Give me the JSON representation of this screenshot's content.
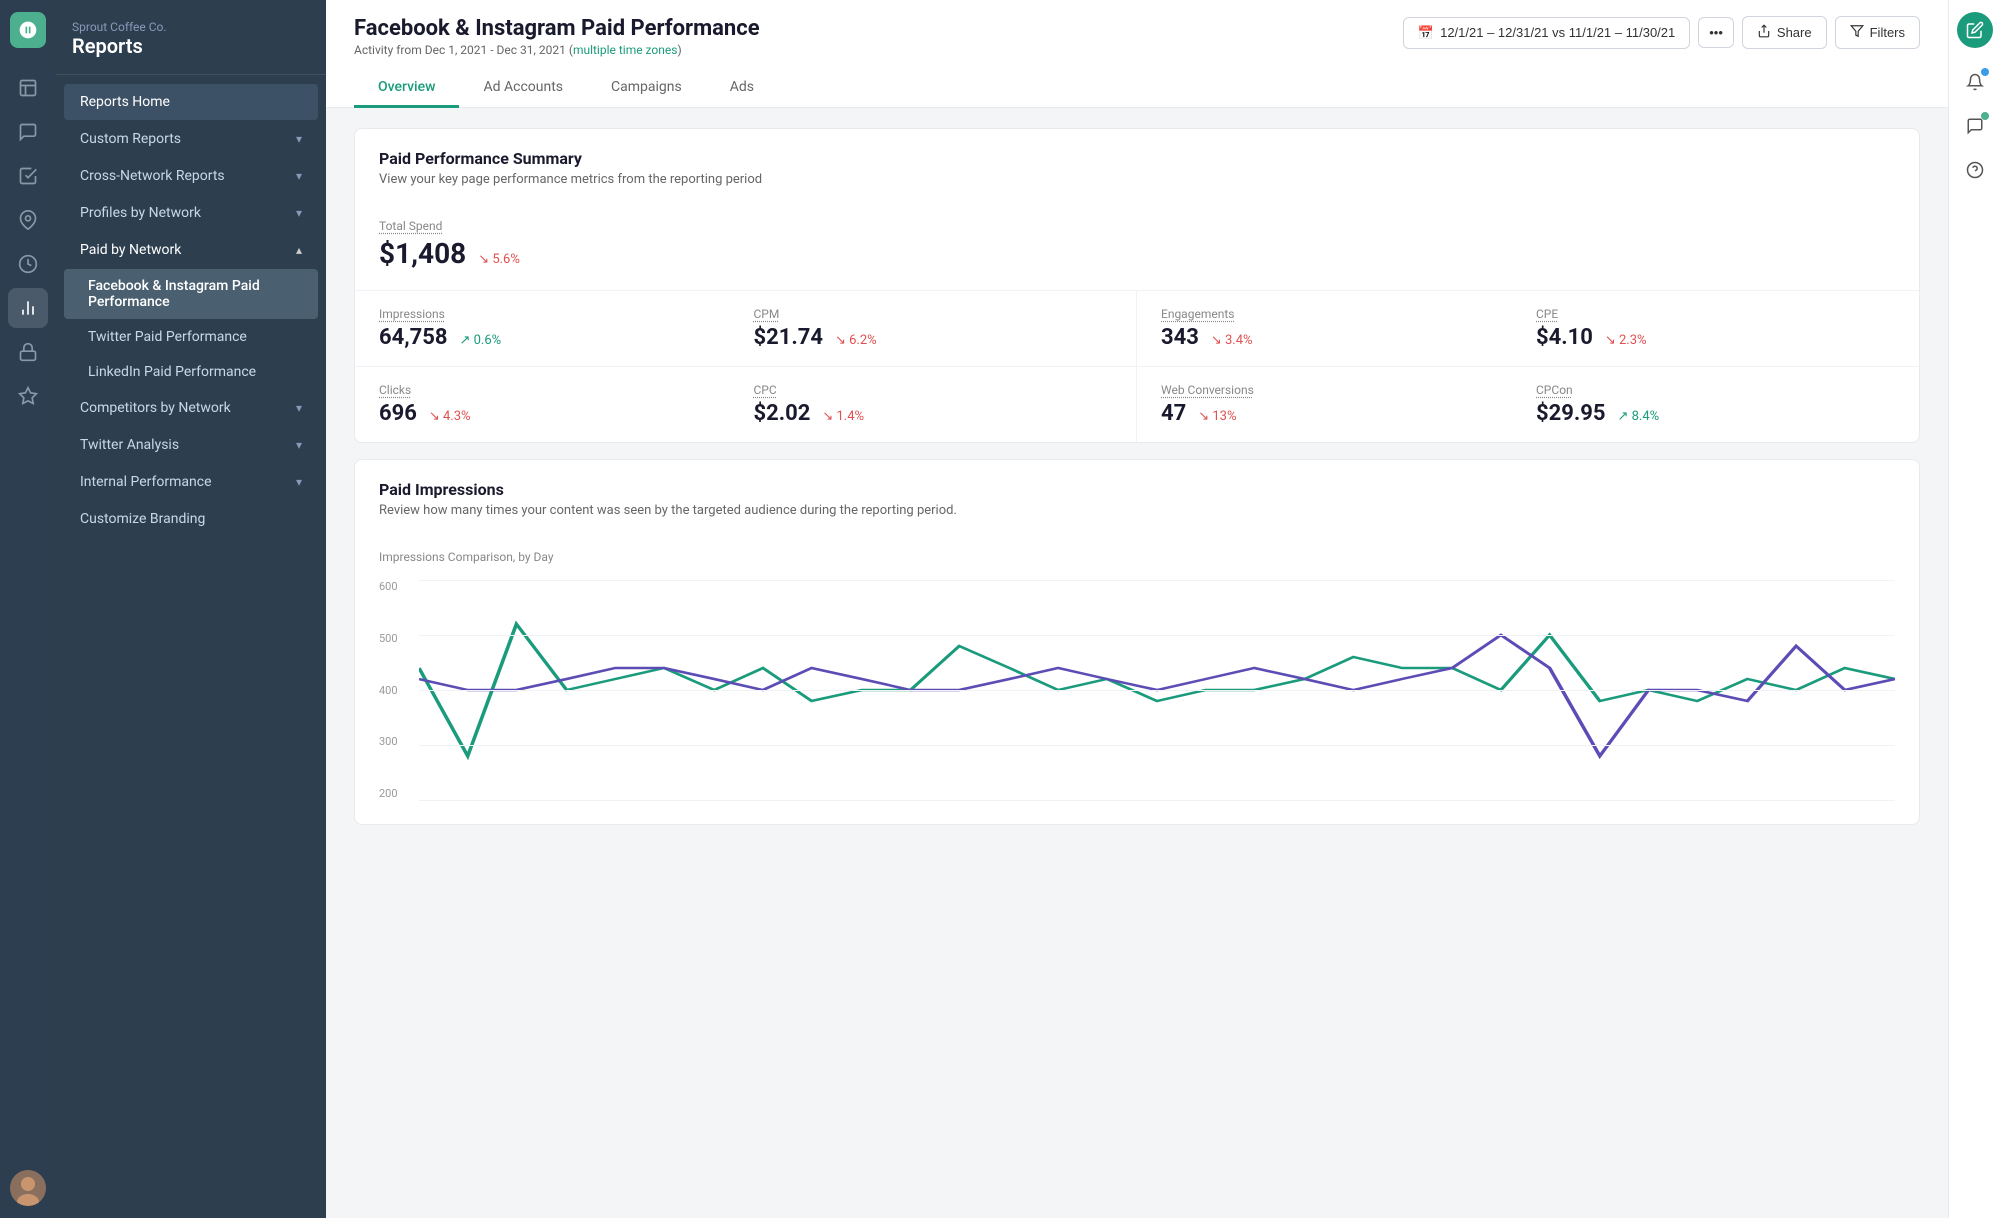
{
  "company": "Sprout Coffee Co.",
  "app_title": "Reports",
  "page_title": "Facebook & Instagram Paid Performance",
  "page_subtitle": "Activity from Dec 1, 2021 - Dec 31, 2021",
  "page_timezone": "multiple time zones",
  "date_range": "12/1/21 – 12/31/21 vs 11/1/21 – 11/30/21",
  "buttons": {
    "share": "Share",
    "filters": "Filters"
  },
  "tabs": [
    {
      "id": "overview",
      "label": "Overview",
      "active": true
    },
    {
      "id": "ad-accounts",
      "label": "Ad Accounts",
      "active": false
    },
    {
      "id": "campaigns",
      "label": "Campaigns",
      "active": false
    },
    {
      "id": "ads",
      "label": "Ads",
      "active": false
    }
  ],
  "sidebar": {
    "items": [
      {
        "id": "reports-home",
        "label": "Reports Home",
        "level": 0,
        "active": false,
        "has_chevron": false
      },
      {
        "id": "custom-reports",
        "label": "Custom Reports",
        "level": 0,
        "active": false,
        "has_chevron": true
      },
      {
        "id": "cross-network-reports",
        "label": "Cross-Network Reports",
        "level": 0,
        "active": false,
        "has_chevron": true
      },
      {
        "id": "profiles-by-network",
        "label": "Profiles by Network",
        "level": 0,
        "active": false,
        "has_chevron": true
      },
      {
        "id": "paid-by-network",
        "label": "Paid by Network",
        "level": 0,
        "active": true,
        "has_chevron": true
      },
      {
        "id": "fb-ig-paid",
        "label": "Facebook & Instagram Paid Performance",
        "level": 1,
        "active": true,
        "has_chevron": false
      },
      {
        "id": "twitter-paid",
        "label": "Twitter Paid Performance",
        "level": 1,
        "active": false,
        "has_chevron": false
      },
      {
        "id": "linkedin-paid",
        "label": "LinkedIn Paid Performance",
        "level": 1,
        "active": false,
        "has_chevron": false
      },
      {
        "id": "competitors-by-network",
        "label": "Competitors by Network",
        "level": 0,
        "active": false,
        "has_chevron": true
      },
      {
        "id": "twitter-analysis",
        "label": "Twitter Analysis",
        "level": 0,
        "active": false,
        "has_chevron": true
      },
      {
        "id": "internal-performance",
        "label": "Internal Performance",
        "level": 0,
        "active": false,
        "has_chevron": true
      },
      {
        "id": "customize-branding",
        "label": "Customize Branding",
        "level": 0,
        "active": false,
        "has_chevron": false
      }
    ]
  },
  "summary_card": {
    "title": "Paid Performance Summary",
    "subtitle": "View your key page performance metrics from the reporting period",
    "total_spend": {
      "label": "Total Spend",
      "value": "$1,408",
      "change": "5.6%",
      "direction": "down"
    },
    "metrics": [
      {
        "col": 0,
        "rows": [
          [
            {
              "label": "Impressions",
              "value": "64,758",
              "change": "0.6%",
              "direction": "up"
            },
            {
              "label": "CPM",
              "value": "$21.74",
              "change": "6.2%",
              "direction": "down"
            }
          ],
          [
            {
              "label": "Clicks",
              "value": "696",
              "change": "4.3%",
              "direction": "down"
            },
            {
              "label": "CPC",
              "value": "$2.02",
              "change": "1.4%",
              "direction": "down"
            }
          ]
        ]
      },
      {
        "col": 1,
        "rows": [
          [
            {
              "label": "Engagements",
              "value": "343",
              "change": "3.4%",
              "direction": "down"
            },
            {
              "label": "CPE",
              "value": "$4.10",
              "change": "2.3%",
              "direction": "down"
            }
          ],
          [
            {
              "label": "Web Conversions",
              "value": "47",
              "change": "13%",
              "direction": "down"
            },
            {
              "label": "CPCon",
              "value": "$29.95",
              "change": "8.4%",
              "direction": "up"
            }
          ]
        ]
      }
    ]
  },
  "impressions_card": {
    "title": "Paid Impressions",
    "subtitle": "Review how many times your content was seen by the targeted audience during the reporting period.",
    "chart_label": "Impressions Comparison, by Day",
    "y_labels": [
      "600",
      "500",
      "400",
      "300",
      "200"
    ],
    "colors": {
      "line1": "#1a9b7b",
      "line2": "#5b4db5"
    }
  },
  "icons": {
    "calendar": "📅",
    "share": "⬆",
    "filter": "⚙",
    "chevron_down": "›",
    "chevron_up": "‹",
    "arrow_down": "↘",
    "arrow_up": "↗"
  }
}
